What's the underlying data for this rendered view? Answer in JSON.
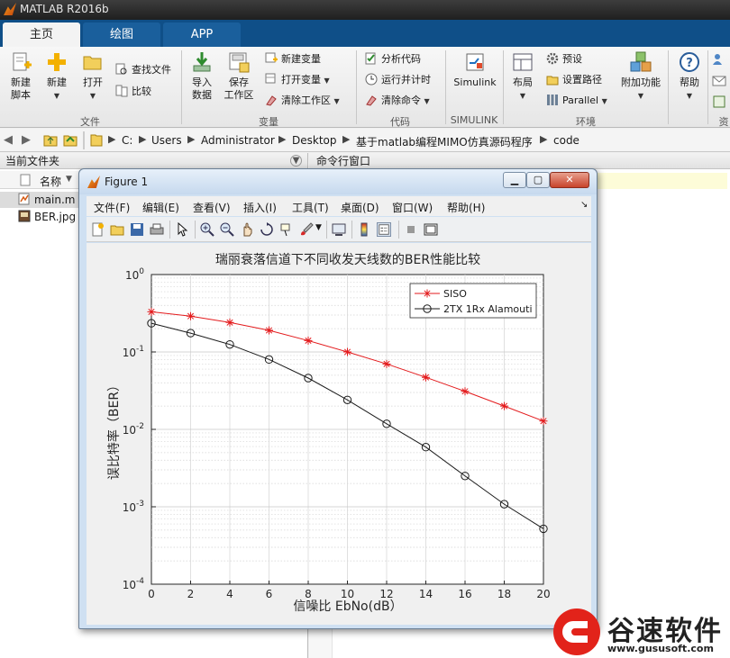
{
  "app": {
    "title": "MATLAB R2016b"
  },
  "tabs": [
    {
      "label": "主页"
    },
    {
      "label": "绘图"
    },
    {
      "label": "APP"
    }
  ],
  "ribbon": {
    "file": {
      "label": "文件",
      "new_script": "新建\n脚本",
      "new": "新建",
      "open": "打开",
      "find_files": "查找文件",
      "compare": "比较"
    },
    "variable": {
      "label": "变量",
      "import": "导入\n数据",
      "save_ws": "保存\n工作区",
      "new_var": "新建变量",
      "open_var": "打开变量",
      "clear_ws": "清除工作区"
    },
    "code": {
      "label": "代码",
      "analyze": "分析代码",
      "run_time": "运行并计时",
      "clear_cmd": "清除命令"
    },
    "simulink": {
      "label": "SIMULINK",
      "btn": "Simulink"
    },
    "env": {
      "label": "环境",
      "layout": "布局",
      "prefs": "预设",
      "set_path": "设置路径",
      "parallel": "Parallel",
      "addons": "附加功能"
    },
    "help": "帮助",
    "res_label": "资"
  },
  "address": {
    "crumbs": [
      "C:",
      "Users",
      "Administrator",
      "Desktop",
      "基于matlab编程MIMO仿真源码程序",
      "code"
    ]
  },
  "left_panel": {
    "title": "当前文件夹",
    "col_name": "名称",
    "files": [
      "main.m",
      "BER.jpg"
    ]
  },
  "right_panel": {
    "title": "命令行窗口"
  },
  "figure": {
    "title": "Figure 1",
    "menu": [
      "文件(F)",
      "编辑(E)",
      "查看(V)",
      "插入(I)",
      "工具(T)",
      "桌面(D)",
      "窗口(W)",
      "帮助(H)"
    ],
    "toolbar_icons": [
      "new-figure-icon",
      "open-icon",
      "save-icon",
      "print-icon",
      "pointer-icon",
      "zoom-in-icon",
      "zoom-out-icon",
      "pan-icon",
      "rotate-icon",
      "data-cursor-icon",
      "brush-icon",
      "link-icon",
      "colorbar-icon",
      "legend-icon",
      "hide-tools-icon",
      "dock-icon"
    ]
  },
  "chart_data": {
    "type": "line",
    "title": "瑞丽衰落信道下不同收发天线数的BER性能比较",
    "xlabel": "信噪比 EbNo(dB）",
    "ylabel": "误比特率（BER）",
    "x": [
      0,
      2,
      4,
      6,
      8,
      10,
      12,
      14,
      16,
      18,
      20
    ],
    "xlim": [
      0,
      20
    ],
    "ylim": [
      0.0001,
      1
    ],
    "yscale": "log",
    "xticks": [
      "0",
      "2",
      "4",
      "6",
      "8",
      "10",
      "12",
      "14",
      "16",
      "18",
      "20"
    ],
    "yticks": [
      {
        "base": "10",
        "exp": "0"
      },
      {
        "base": "10",
        "exp": "-1"
      },
      {
        "base": "10",
        "exp": "-2"
      },
      {
        "base": "10",
        "exp": "-3"
      },
      {
        "base": "10",
        "exp": "-4"
      }
    ],
    "grid": true,
    "legend_position": "top-right",
    "series": [
      {
        "name": "SISO",
        "color": "#e31a1c",
        "marker": "asterisk",
        "values": [
          0.33,
          0.29,
          0.24,
          0.19,
          0.14,
          0.1,
          0.07,
          0.047,
          0.031,
          0.02,
          0.0128
        ]
      },
      {
        "name": "2TX 1Rx Alamouti",
        "color": "#1a1a1a",
        "marker": "circle",
        "values": [
          0.235,
          0.175,
          0.125,
          0.08,
          0.046,
          0.024,
          0.0118,
          0.0059,
          0.0025,
          0.00108,
          0.00052
        ]
      }
    ]
  },
  "watermark": {
    "brand": "谷速软件",
    "url": "www.gususoft.com"
  }
}
